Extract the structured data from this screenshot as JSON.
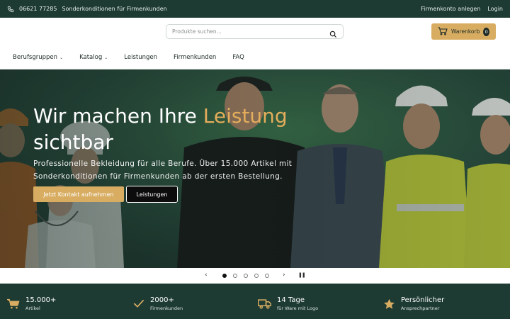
{
  "topbar": {
    "phone": "06621 77285",
    "promo": "Sonderkonditionen für Firmenkunden",
    "create_account": "Firmenkonto anlegen",
    "login": "Login"
  },
  "header": {
    "search_placeholder": "Produkte suchen...",
    "cart_label": "Warenkorb",
    "cart_count": "0"
  },
  "nav": {
    "items": [
      {
        "label": "Berufsgruppen",
        "dropdown": true
      },
      {
        "label": "Katalog",
        "dropdown": true
      },
      {
        "label": "Leistungen",
        "dropdown": false
      },
      {
        "label": "Firmenkunden",
        "dropdown": false
      },
      {
        "label": "FAQ",
        "dropdown": false
      }
    ]
  },
  "hero": {
    "title_start": "Wir machen Ihre ",
    "title_accent": "Leistung",
    "title_end": "sichtbar",
    "subtitle": "Professionelle Bekleidung für alle Berufe. Über 15.000 Artikel mit Sonderkonditionen für Firmenkunden ab der ersten Bestellung.",
    "cta_primary": "Jetzt Kontakt aufnehmen",
    "cta_secondary": "Leistungen"
  },
  "carousel": {
    "slides": 5,
    "active": 0,
    "prev_icon": "chevron-left-icon",
    "next_icon": "chevron-right-icon",
    "pause_icon": "pause-icon"
  },
  "features": [
    {
      "value": "15.000+",
      "label": "Artikel",
      "icon": "cart-icon"
    },
    {
      "value": "2000+",
      "label": "Firmenkunden",
      "icon": "check-icon"
    },
    {
      "value": "14 Tage",
      "label": "für Ware mit Logo",
      "icon": "truck-icon"
    },
    {
      "value": "Persönlicher",
      "label": "Ansprechpartner",
      "icon": "star-icon"
    }
  ],
  "colors": {
    "dark_green": "#1d3a33",
    "accent_gold": "#d8ad62",
    "title_accent": "#e4ad5b"
  }
}
